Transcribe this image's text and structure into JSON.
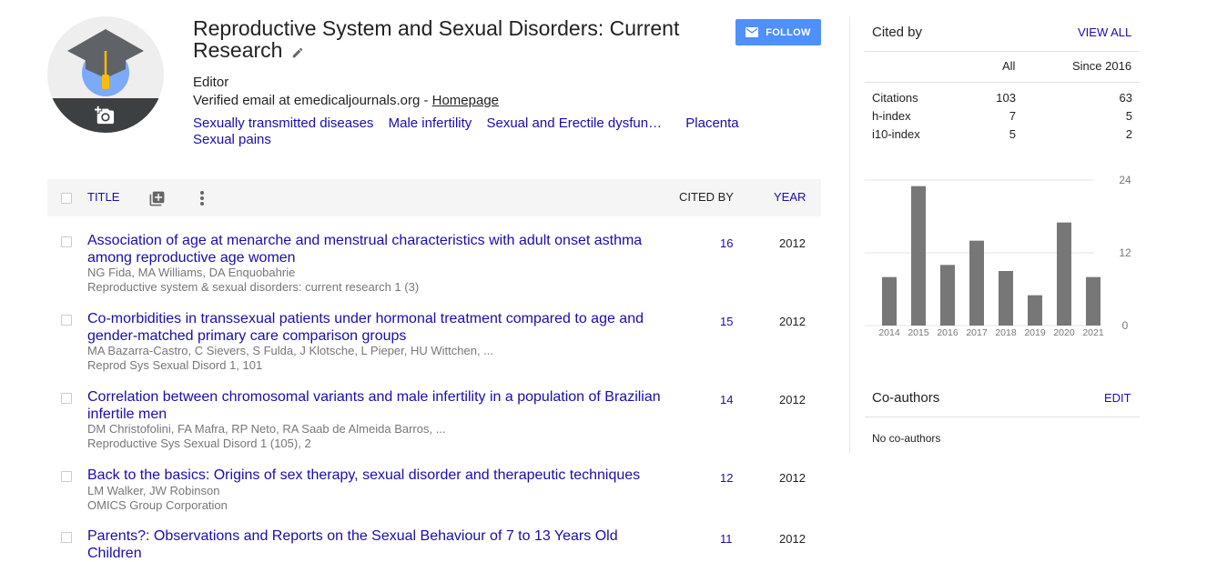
{
  "profile": {
    "name": "Reproductive System and Sexual Disorders: Current Research",
    "affiliation": "Editor",
    "email_text": "Verified email at emedicaljournals.org - ",
    "homepage_label": "Homepage",
    "interests": [
      "Sexually transmitted diseases",
      "Male infertility",
      "Sexual and Erectile dysfun…",
      "Placenta",
      "Sexual pains"
    ],
    "follow_label": "FOLLOW"
  },
  "table": {
    "title_header": "TITLE",
    "cited_header": "CITED BY",
    "year_header": "YEAR",
    "articles": [
      {
        "title": "Association of age at menarche and menstrual characteristics with adult onset asthma among reproductive age women",
        "authors": "NG Fida, MA Williams, DA Enquobahrie",
        "publication": "Reproductive system & sexual disorders: current research 1 (3)",
        "cited": "16",
        "year": "2012"
      },
      {
        "title": "Co-morbidities in transsexual patients under hormonal treatment compared to age and gender-matched primary care comparison groups",
        "authors": "MA Bazarra-Castro, C Sievers, S Fulda, J Klotsche, L Pieper, HU Wittchen, ...",
        "publication": "Reprod Sys Sexual Disord 1, 101",
        "cited": "15",
        "year": "2012"
      },
      {
        "title": "Correlation between chromosomal variants and male infertility in a population of Brazilian infertile men",
        "authors": "DM Christofolini, FA Mafra, RP Neto, RA Saab de Almeida Barros, ...",
        "publication": "Reproductive Sys Sexual Disord 1 (105), 2",
        "cited": "14",
        "year": "2012"
      },
      {
        "title": "Back to the basics: Origins of sex therapy, sexual disorder and therapeutic techniques",
        "authors": "LM Walker, JW Robinson",
        "publication": "OMICS Group Corporation",
        "cited": "12",
        "year": "2012"
      },
      {
        "title": "Parents?: Observations and Reports on the Sexual Behaviour of 7 to 13 Years Old Children",
        "authors": "",
        "publication": "",
        "cited": "11",
        "year": "2012"
      }
    ]
  },
  "cited_by": {
    "heading": "Cited by",
    "view_all": "VIEW ALL",
    "col_all": "All",
    "col_since": "Since 2016",
    "rows": [
      {
        "label": "Citations",
        "all": "103",
        "since": "63"
      },
      {
        "label": "h-index",
        "all": "7",
        "since": "5"
      },
      {
        "label": "i10-index",
        "all": "5",
        "since": "2"
      }
    ]
  },
  "chart_data": {
    "type": "bar",
    "categories": [
      "2014",
      "2015",
      "2016",
      "2017",
      "2018",
      "2019",
      "2020",
      "2021"
    ],
    "values": [
      8,
      23,
      10,
      14,
      9,
      5,
      17,
      8
    ],
    "y_ticks": [
      "24",
      "12",
      "0"
    ],
    "ylim": [
      0,
      24
    ],
    "grid": true,
    "bar_color": "#777777"
  },
  "coauthors": {
    "heading": "Co-authors",
    "edit_label": "EDIT",
    "empty_text": "No co-authors"
  },
  "colors": {
    "link": "#1a0dab",
    "follow_button": "#4d90fe",
    "header_bg": "#f5f5f5"
  }
}
